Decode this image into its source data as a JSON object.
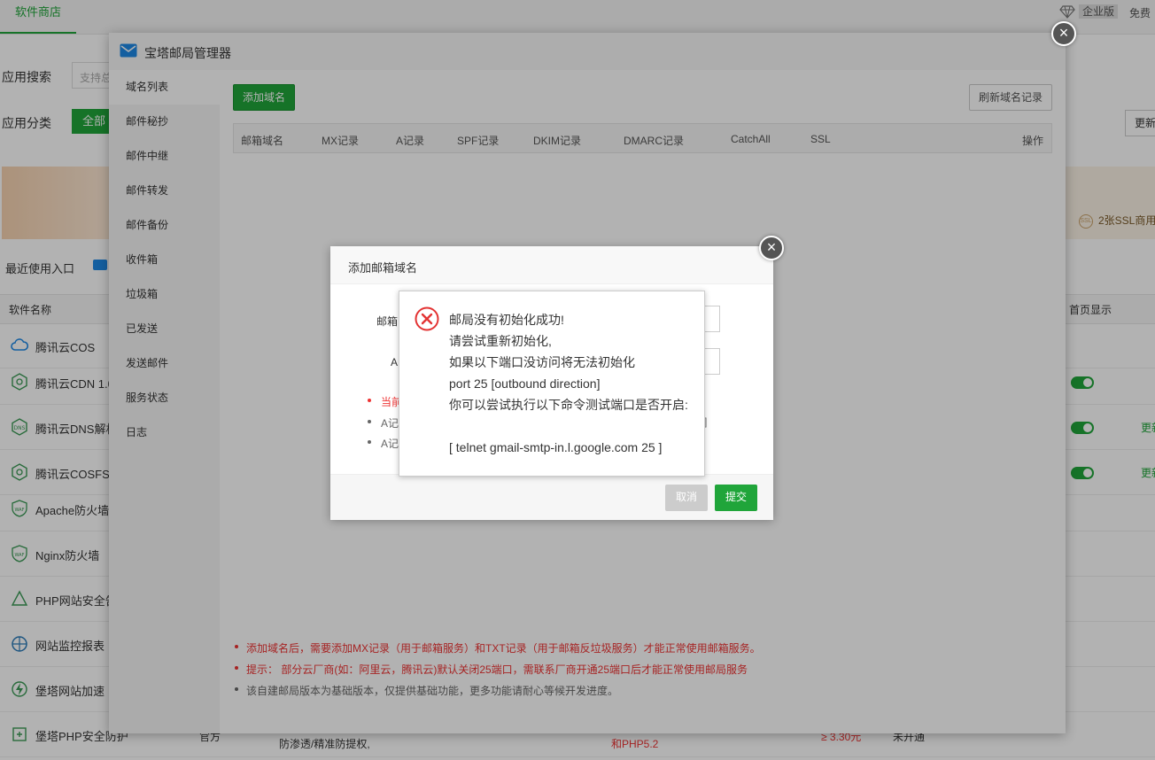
{
  "background": {
    "top_tab": "软件商店",
    "edition_badge": "企业版",
    "free_text": "免费",
    "search_label": "应用搜索",
    "search_placeholder": "支持总",
    "category_label": "应用分类",
    "category_all": "全部",
    "ssl_text": "2张SSL商用",
    "ssl_icon_text": "SSL",
    "recent_label": "最近使用入口",
    "update_btn": "更新",
    "table_header_name": "软件名称",
    "table_header_home": "首页显示",
    "rows": [
      {
        "name": "腾讯云COS",
        "toggle": false,
        "update": ""
      },
      {
        "name": "腾讯云CDN 1.0",
        "toggle": true,
        "update": ""
      },
      {
        "name": "腾讯云DNS解析",
        "toggle": true,
        "update": "更新"
      },
      {
        "name": "腾讯云COSFS 2",
        "toggle": true,
        "update": "更新"
      },
      {
        "name": "Apache防火墙",
        "toggle": false,
        "update": ""
      },
      {
        "name": "Nginx防火墙",
        "toggle": false,
        "update": ""
      },
      {
        "name": "PHP网站安全告",
        "toggle": false,
        "update": ""
      },
      {
        "name": "网站监控报表",
        "toggle": false,
        "update": ""
      },
      {
        "name": "堡塔网站加速",
        "toggle": false,
        "update": ""
      },
      {
        "name": "堡塔PHP安全防护",
        "toggle": false,
        "update": ""
      }
    ],
    "last_row_extras": {
      "col_official": "官方",
      "col_desc": "防渗透/精准防提权,",
      "col_php": "和PHP5.2",
      "col_price": "≥ 3.30元",
      "col_status": "未开通"
    }
  },
  "mail_window": {
    "title": "宝塔邮局管理器",
    "sidebar": [
      {
        "label": "域名列表",
        "active": true
      },
      {
        "label": "邮件秘抄",
        "active": false
      },
      {
        "label": "邮件中继",
        "active": false
      },
      {
        "label": "邮件转发",
        "active": false
      },
      {
        "label": "邮件备份",
        "active": false
      },
      {
        "label": "收件箱",
        "active": false
      },
      {
        "label": "垃圾箱",
        "active": false
      },
      {
        "label": "已发送",
        "active": false
      },
      {
        "label": "发送邮件",
        "active": false
      },
      {
        "label": "服务状态",
        "active": false
      },
      {
        "label": "日志",
        "active": false
      }
    ],
    "add_domain_btn": "添加域名",
    "refresh_btn": "刷新域名记录",
    "columns": [
      "邮箱域名",
      "MX记录",
      "A记录",
      "SPF记录",
      "DKIM记录",
      "DMARC记录",
      "CatchAll",
      "SSL",
      "操作"
    ],
    "notes": [
      {
        "text": "添加域名后，需要添加MX记录（用于邮箱服务）和TXT记录（用于邮箱反垃圾服务）才能正常使用邮箱服务。",
        "color": "red"
      },
      {
        "text": "提示： 部分云厂商(如：阿里云，腾讯云)默认关闭25端口，需联系厂商开通25端口后才能正常使用邮局服务",
        "color": "red"
      },
      {
        "text": "该自建邮局版本为基础版本，仅提供基础功能，更多功能请耐心等候开发进度。",
        "color": "grey"
      }
    ]
  },
  "add_dialog": {
    "title": "添加邮箱域名",
    "label_domain": "邮箱",
    "label_a": "A",
    "tip_red": "当前",
    "tip_a1": "A记",
    "tip_a2": "A记",
    "tip_suffix": "]",
    "cancel_btn": "取消",
    "submit_btn": "提交"
  },
  "error_box": {
    "lines": [
      "邮局没有初始化成功!",
      "请尝试重新初始化,",
      "如果以下端口没访问将无法初始化",
      "port 25 [outbound direction]",
      "你可以尝试执行以下命令测试端口是否开启:",
      "",
      "[ telnet gmail-smtp-in.l.google.com 25 ]"
    ]
  },
  "colors": {
    "accent": "#20a53a",
    "error": "#e33333",
    "close_button": "#555555"
  }
}
